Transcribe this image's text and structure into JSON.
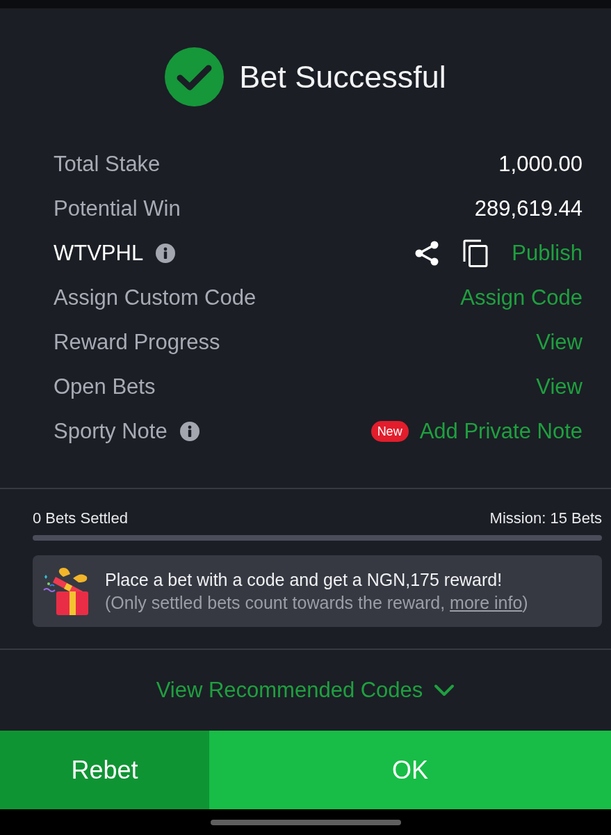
{
  "header": {
    "title": "Bet Successful"
  },
  "summary_rows": [
    {
      "kind": "value",
      "label": "Total Stake",
      "info": false,
      "value": "1,000.00"
    },
    {
      "kind": "value",
      "label": "Potential Win",
      "info": false,
      "value": "289,619.44"
    },
    {
      "kind": "code",
      "label": "WTVPHL",
      "info": true,
      "action": "Publish"
    },
    {
      "kind": "link",
      "label": "Assign Custom Code",
      "info": false,
      "action": "Assign Code"
    },
    {
      "kind": "link",
      "label": "Reward Progress",
      "info": false,
      "action": "View"
    },
    {
      "kind": "link",
      "label": "Open Bets",
      "info": false,
      "action": "View"
    },
    {
      "kind": "link",
      "label": "Sporty Note",
      "info": true,
      "badge": "New",
      "action": "Add Private Note"
    }
  ],
  "progress": {
    "settled": "0 Bets Settled",
    "mission": "Mission: 15 Bets",
    "level": 0
  },
  "reward_card": {
    "headline": "Place a bet with a code and get a NGN,175 reward!",
    "note_before": "(Only settled bets count towards the reward, ",
    "link": "more info",
    "note_after": ")"
  },
  "recommended": {
    "label": "View Recommended Codes",
    "expanded": false
  },
  "buttons": [
    {
      "kind": "secondary",
      "label": "Rebet"
    },
    {
      "kind": "primary",
      "label": "OK"
    }
  ]
}
